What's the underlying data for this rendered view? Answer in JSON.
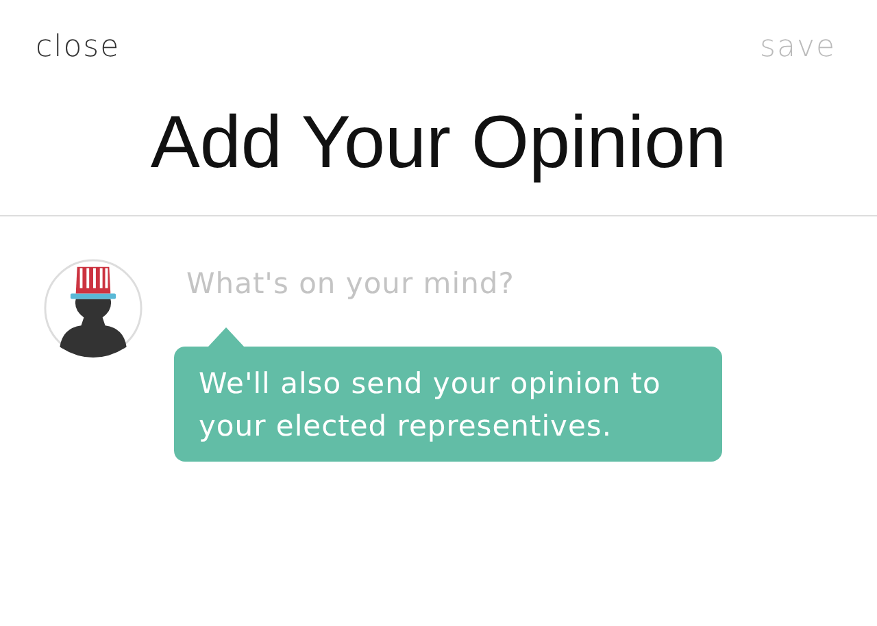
{
  "nav": {
    "close": "close",
    "save": "save",
    "save_disabled": true
  },
  "title": "Add Your Opinion",
  "composer": {
    "placeholder": "What's on your mind?"
  },
  "tooltip": {
    "text": "We'll also send your opinion to your elected representives."
  }
}
